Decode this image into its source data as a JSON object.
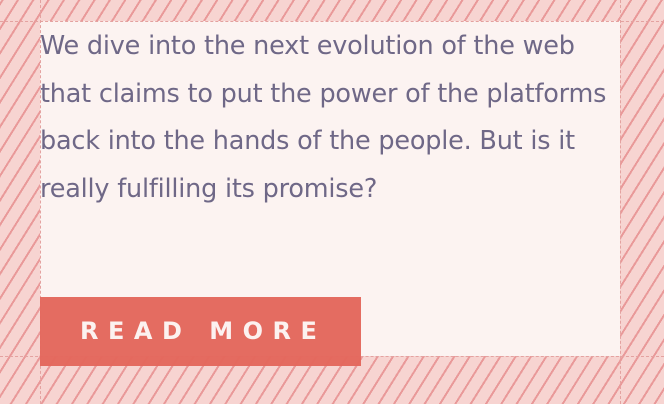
{
  "card": {
    "description": "We dive into the next evolution of the web that claims to put the power of the platforms back into the hands of the people. But is it really fulfilling its promise?",
    "cta_label": "READ MORE"
  },
  "colors": {
    "background": "#f7d4d1",
    "content_background": "#fcf3f1",
    "text": "#6f6887",
    "button": "#e4685d",
    "button_text": "#fdf2f0",
    "guide_lines": "#e4a2a0"
  }
}
